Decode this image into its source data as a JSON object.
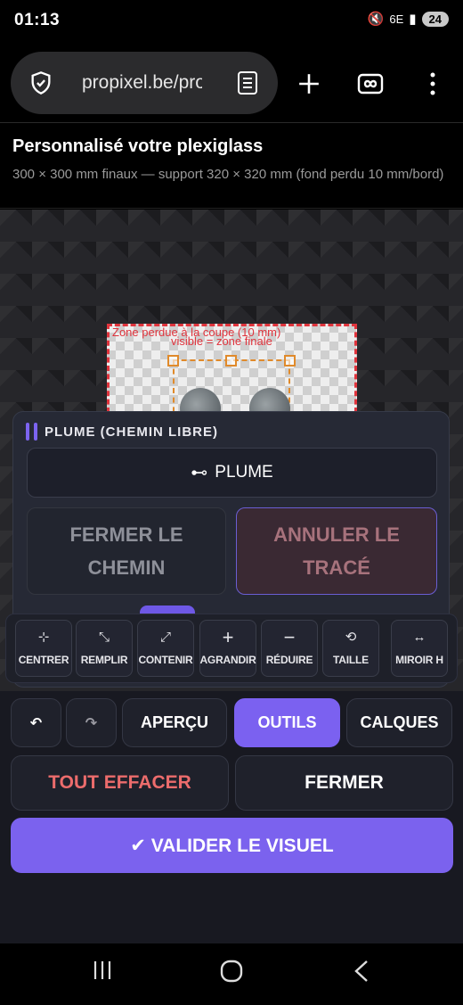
{
  "status_bar": {
    "time": "01:13",
    "network": "6E",
    "battery": "24"
  },
  "browser": {
    "url": "propixel.be/pro",
    "icons": [
      "shield-icon",
      "reader-mode-icon",
      "new-tab-icon",
      "tabs-icon",
      "menu-icon"
    ]
  },
  "page": {
    "title": "Personnalisé votre plexiglass",
    "subtitle": "300 × 300 mm finaux — support 320 × 320 mm (fond perdu 10 mm/bord)"
  },
  "canvas": {
    "bleed_label": "Zone perdue à la coupe (10 mm)",
    "visible_label": "visible = zone finale"
  },
  "tool_panel": {
    "title": "PLUME (CHEMIN LIBRE)",
    "plume_button": "PLUME",
    "close_path_button": "FERMER LE CHEMIN",
    "cancel_path_button": "ANNULER LE TRACÉ"
  },
  "toolbar": {
    "tools": [
      {
        "label": "CENTRER",
        "icon": "⊹"
      },
      {
        "label": "REMPLIR",
        "icon": "⤡"
      },
      {
        "label": "CONTENIR",
        "icon": "⤢"
      },
      {
        "label": "AGRANDIR",
        "icon": "+"
      },
      {
        "label": "RÉDUIRE",
        "icon": "−"
      },
      {
        "label": "TAILLE",
        "icon": "⟲"
      },
      {
        "label": "MIROIR H",
        "icon": "↔"
      }
    ]
  },
  "bottom": {
    "undo_icon": "↶",
    "redo_icon": "↷",
    "apercu": "APERÇU",
    "outils": "OUTILS",
    "calques": "CALQUES",
    "clear_all": "TOUT EFFACER",
    "close": "FERMER",
    "validate": "✔ VALIDER LE VISUEL"
  },
  "colors": {
    "accent": "#7b61f0",
    "danger": "#ec6c6c",
    "bleed": "#e0343d",
    "safe": "#e08a2b"
  }
}
